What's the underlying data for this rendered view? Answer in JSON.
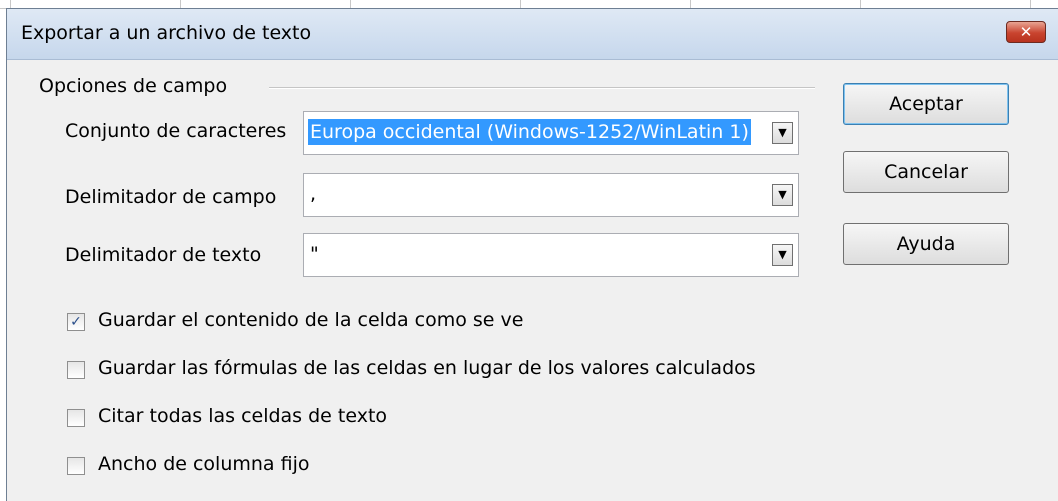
{
  "dialog": {
    "title": "Exportar a un archivo de texto",
    "close_symbol": "✕",
    "group_label": "Opciones de campo"
  },
  "fields": [
    {
      "label": "Conjunto de caracteres",
      "value": "Europa occidental (Windows-1252/WinLatin 1)"
    },
    {
      "label": "Delimitador de campo",
      "value": ","
    },
    {
      "label": "Delimitador de texto",
      "value": "\""
    }
  ],
  "checkboxes": [
    {
      "label": "Guardar el contenido de la celda como se ve",
      "checked": true
    },
    {
      "label": "Guardar las fórmulas de las celdas en lugar de los valores calculados",
      "checked": false
    },
    {
      "label": "Citar todas las celdas de texto",
      "checked": false
    },
    {
      "label": "Ancho de columna fijo",
      "checked": false
    }
  ],
  "buttons": {
    "ok": "Aceptar",
    "cancel": "Cancelar",
    "help": "Ayuda"
  },
  "colors": {
    "titlebar": "#c6d7ec",
    "close": "#c9442f",
    "selection": "#3399ff"
  }
}
